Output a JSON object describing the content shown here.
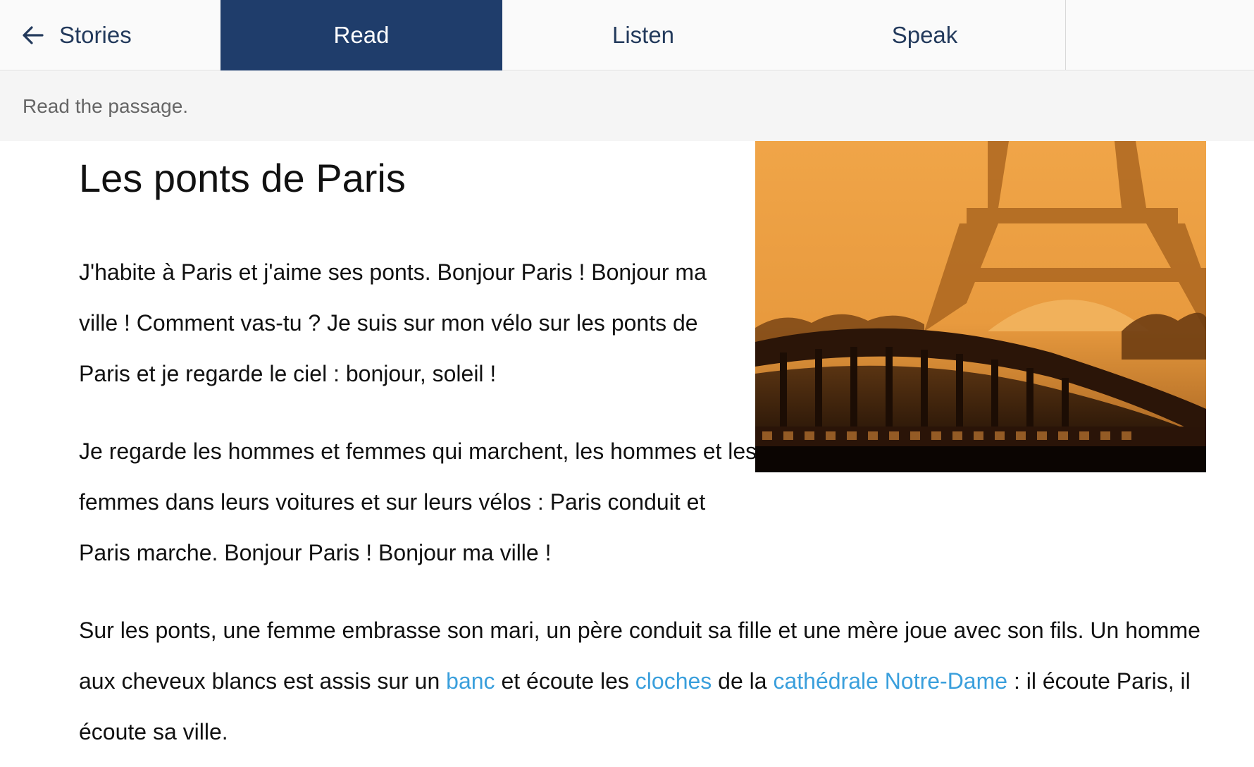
{
  "nav": {
    "back_label": "Stories",
    "tabs": [
      {
        "label": "Read",
        "active": true
      },
      {
        "label": "Listen",
        "active": false
      },
      {
        "label": "Speak",
        "active": false
      }
    ]
  },
  "instruction": "Read the passage.",
  "story": {
    "title": "Les ponts de Paris",
    "p1": "J'habite à Paris et j'aime ses ponts. Bonjour Paris ! Bonjour ma ville ! Comment vas-tu ? Je suis sur mon vélo sur les ponts de Paris et je regarde le ciel : bonjour, soleil !",
    "p2": "Je regarde les hommes et femmes qui marchent, les hommes et les femmes dans leurs voitures et sur leurs vélos : Paris conduit et Paris marche. Bonjour Paris ! Bonjour ma ville !",
    "p3": {
      "t1": "Sur les ponts, une femme embrasse son mari, un père conduit sa fille et une mère joue avec son fils. Un homme aux cheveux blancs est assis sur un ",
      "link1": "banc",
      "t2": " et écoute les ",
      "link2": "cloches",
      "t3": " de la ",
      "link3": "cathédrale Notre-Dame",
      "t4": " : il écoute Paris, il écoute sa ville."
    }
  },
  "colors": {
    "nav_active_bg": "#1f3d6b",
    "nav_text": "#233a5c",
    "link": "#3a9fdc"
  },
  "icons": {
    "back": "arrow-left-icon"
  }
}
